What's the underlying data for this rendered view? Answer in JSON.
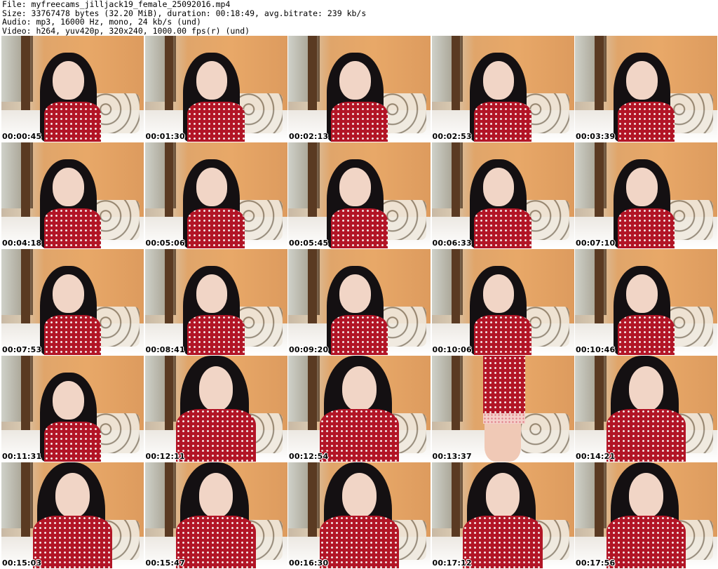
{
  "header": {
    "file_line": "File: myfreecams_jilljack19_female_25092016.mp4",
    "size_line": "Size: 33767478 bytes (32.20 MiB), duration: 00:18:49, avg.bitrate: 239 kb/s",
    "audio_line": "Audio: mp3, 16000 Hz, mono, 24 kb/s (und)",
    "video_line": "Video: h264, yuv420p, 320x240, 1000.00 fps(r) (und)"
  },
  "thumbnails": [
    {
      "timestamp": "00:00:45"
    },
    {
      "timestamp": "00:01:30"
    },
    {
      "timestamp": "00:02:13"
    },
    {
      "timestamp": "00:02:53"
    },
    {
      "timestamp": "00:03:39"
    },
    {
      "timestamp": "00:04:18"
    },
    {
      "timestamp": "00:05:06"
    },
    {
      "timestamp": "00:05:45"
    },
    {
      "timestamp": "00:06:33"
    },
    {
      "timestamp": "00:07:10"
    },
    {
      "timestamp": "00:07:53"
    },
    {
      "timestamp": "00:08:41"
    },
    {
      "timestamp": "00:09:20"
    },
    {
      "timestamp": "00:10:06"
    },
    {
      "timestamp": "00:10:46"
    },
    {
      "timestamp": "00:11:31"
    },
    {
      "timestamp": "00:12:11"
    },
    {
      "timestamp": "00:12:54"
    },
    {
      "timestamp": "00:13:37"
    },
    {
      "timestamp": "00:14:21"
    },
    {
      "timestamp": "00:15:03"
    },
    {
      "timestamp": "00:15:47"
    },
    {
      "timestamp": "00:16:30"
    },
    {
      "timestamp": "00:17:12"
    },
    {
      "timestamp": "00:17:56"
    }
  ]
}
